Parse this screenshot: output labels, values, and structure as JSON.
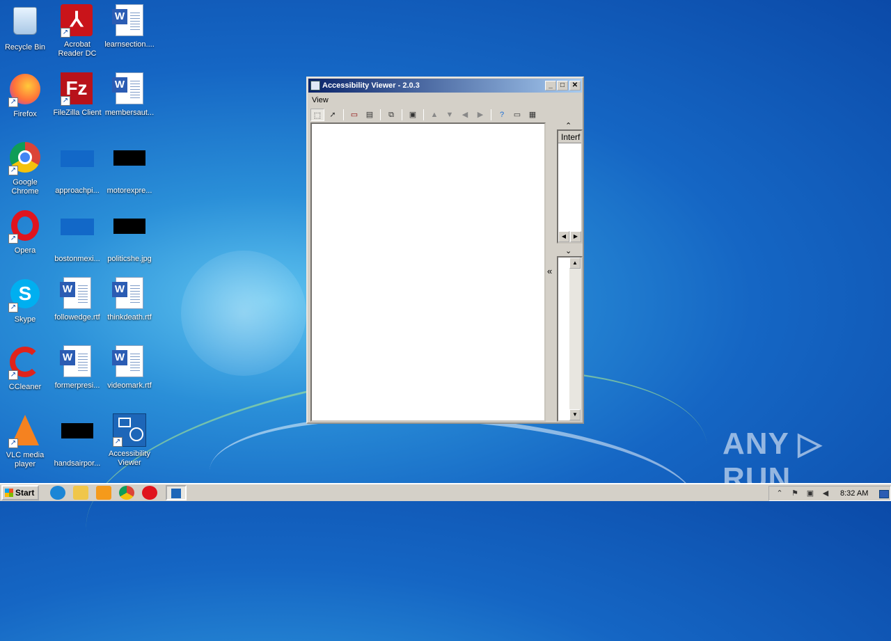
{
  "desktop": {
    "icons": [
      {
        "label": "Recycle Bin"
      },
      {
        "label": "Acrobat Reader DC"
      },
      {
        "label": "learnsection...."
      },
      {
        "label": "Firefox"
      },
      {
        "label": "FileZilla Client"
      },
      {
        "label": "membersaut..."
      },
      {
        "label": "Google Chrome"
      },
      {
        "label": "approachpi..."
      },
      {
        "label": "motorexpre..."
      },
      {
        "label": "Opera"
      },
      {
        "label": "bostonmexi..."
      },
      {
        "label": "politicshe.jpg"
      },
      {
        "label": "Skype"
      },
      {
        "label": "followedge.rtf"
      },
      {
        "label": "thinkdeath.rtf"
      },
      {
        "label": "CCleaner"
      },
      {
        "label": "formerpresi..."
      },
      {
        "label": "videomark.rtf"
      },
      {
        "label": "VLC media player"
      },
      {
        "label": "handsairpor..."
      },
      {
        "label": "Accessibility Viewer"
      }
    ]
  },
  "window": {
    "title": "Accessibility Viewer - 2.0.3",
    "menu": [
      "View"
    ],
    "tab_label": "Interf",
    "collapse_glyph": "«",
    "up_glyph": "⌃",
    "down_glyph": "⌄",
    "controls": {
      "minimize": "_",
      "maximize": "□",
      "close": "✕"
    }
  },
  "watermark": "ANY ▷ RUN",
  "taskbar": {
    "start_label": "Start",
    "clock": "8:32 AM"
  }
}
